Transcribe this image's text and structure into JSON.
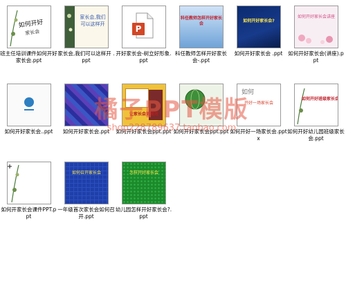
{
  "files": [
    {
      "name": "班主任培训课件如何开好家长会.ppt",
      "thumb": "floral-cover",
      "label": "如何开好家长会"
    },
    {
      "name": "家长会,我们可以这样开 .ppt",
      "thumb": "plant-title",
      "label": "家长会,我们可以这样开"
    },
    {
      "name": "开好家长会-树立好形象.ppt",
      "thumb": "ppt-file-icon",
      "label": ""
    },
    {
      "name": "科任教师怎样开好家长会-.ppt",
      "thumb": "blue-gradient",
      "label": "科任教师怎样开好家长会"
    },
    {
      "name": "如何开好家长会 .ppt",
      "thumb": "dark-blue",
      "label": "如何开好家长会?"
    },
    {
      "name": "如何开好家长会(讲座).ppt",
      "thumb": "pink-floral",
      "label": "如何开好家长会讲座"
    },
    {
      "name": "如何开好家长会..ppt",
      "thumb": "white-logo",
      "label": ""
    },
    {
      "name": "如何开好家长会.ppt",
      "thumb": "blue-purple-pattern",
      "label": ""
    },
    {
      "name": "如何开好家长会ppt.ppt",
      "thumb": "photo-collage",
      "label": "让家长会更高效"
    },
    {
      "name": "如何开好家长会ppt.ppt",
      "thumb": "green-globe",
      "label": ""
    },
    {
      "name": "如何开好一场家长会.pptx",
      "thumb": "white-title",
      "label": "开好一场家长会"
    },
    {
      "name": "如何开好幼儿园班级家长会.ppt",
      "thumb": "floral-red",
      "label": "如何开好班级家长会"
    },
    {
      "name": "如何开家长会课件PPT.ppt",
      "thumb": "floral-plain",
      "label": ""
    },
    {
      "name": "一年级首次家长会如何召开.ppt",
      "thumb": "blue-grid",
      "label": "如何召开家长会"
    },
    {
      "name": "幼儿园怎样开好家长会?.ppt",
      "thumb": "green-plain",
      "label": "怎样开好家长会"
    }
  ],
  "watermark": {
    "title": "橘子PPT模版",
    "url": "shop228789637.taobao.com"
  }
}
